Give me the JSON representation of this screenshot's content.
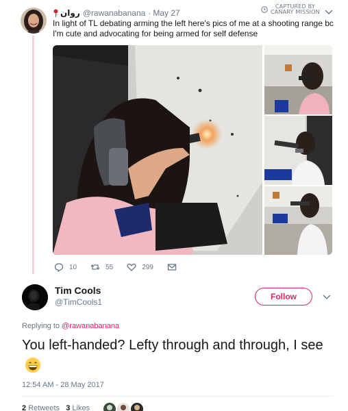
{
  "watermark": {
    "line1": "CAPTURED BY",
    "line2": "CANARY MISSION"
  },
  "tweet1": {
    "display_name": "روان",
    "handle": "@rawanabanana",
    "separator": "·",
    "date": "May 27",
    "text": "In light of TL debating arming the left here's pics of me at a shooting range bc I'm cute and advocating for being armed for self defense",
    "actions": {
      "replies": "10",
      "retweets": "55",
      "likes": "299"
    },
    "media": [
      "shooting-range-main-photo",
      "shooting-range-photo-2",
      "shooting-range-photo-3",
      "shooting-range-photo-4"
    ]
  },
  "tweet2": {
    "display_name": "Tim Cools",
    "handle": "@TimCools1",
    "follow_label": "Follow",
    "replying_prefix": "Replying to",
    "replying_handle": "@rawanabanana",
    "text": "You left-handed? Lefty through and through, I see",
    "emoji": "grinning-face-emoji",
    "timestamp": "12:54 AM - 28 May 2017",
    "retweets_count": "2",
    "retweets_label": "Retweets",
    "likes_count": "3",
    "likes_label": "Likes"
  },
  "colors": {
    "accent": "#e0245e",
    "thread_line": "#f1d3dc",
    "muted": "#657786"
  }
}
